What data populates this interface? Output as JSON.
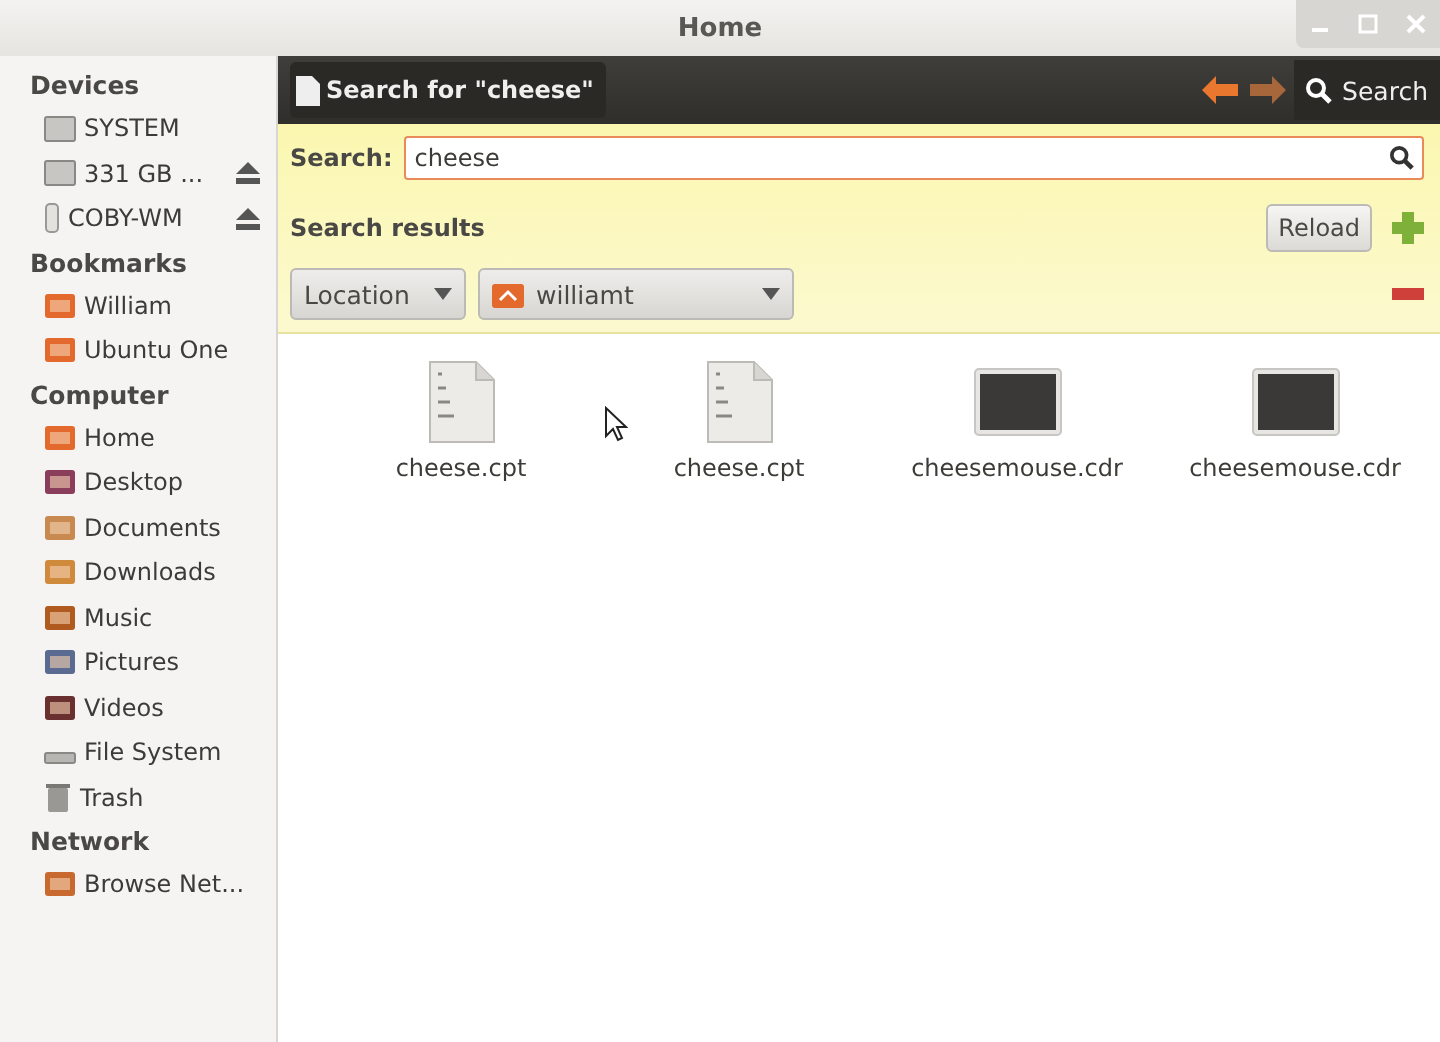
{
  "window": {
    "title": "Home"
  },
  "sidebar": [
    {
      "heading": "Devices",
      "items": [
        {
          "label": "SYSTEM",
          "kind": "drive",
          "ejectable": false
        },
        {
          "label": "331 GB ...",
          "kind": "drive",
          "ejectable": true
        },
        {
          "label": "COBY-WM",
          "kind": "usb",
          "ejectable": true
        }
      ]
    },
    {
      "heading": "Bookmarks",
      "items": [
        {
          "label": "William",
          "kind": "folder",
          "ejectable": false
        },
        {
          "label": "Ubuntu One",
          "kind": "folder",
          "ejectable": false
        }
      ]
    },
    {
      "heading": "Computer",
      "items": [
        {
          "label": "Home",
          "kind": "home",
          "ejectable": false
        },
        {
          "label": "Desktop",
          "kind": "desktop",
          "ejectable": false
        },
        {
          "label": "Documents",
          "kind": "documents",
          "ejectable": false
        },
        {
          "label": "Downloads",
          "kind": "downloads",
          "ejectable": false
        },
        {
          "label": "Music",
          "kind": "music",
          "ejectable": false
        },
        {
          "label": "Pictures",
          "kind": "pictures",
          "ejectable": false
        },
        {
          "label": "Videos",
          "kind": "videos",
          "ejectable": false
        },
        {
          "label": "File System",
          "kind": "filesystem",
          "ejectable": false
        },
        {
          "label": "Trash",
          "kind": "trash",
          "ejectable": false
        }
      ]
    },
    {
      "heading": "Network",
      "items": [
        {
          "label": "Browse Net...",
          "kind": "network",
          "ejectable": false
        }
      ]
    }
  ],
  "toolbar": {
    "location": "Search for \"cheese\"",
    "search_button": "Search"
  },
  "search": {
    "label": "Search:",
    "value": "cheese"
  },
  "results": {
    "title": "Search results",
    "reload": "Reload",
    "location_filter": "Location",
    "folder": "williamt"
  },
  "files": [
    {
      "name": "cheese.cpt",
      "kind": "binary"
    },
    {
      "name": "cheese.cpt",
      "kind": "binary"
    },
    {
      "name": "cheesemouse.cdr",
      "kind": "image"
    },
    {
      "name": "cheesemouse.cdr",
      "kind": "image"
    }
  ]
}
